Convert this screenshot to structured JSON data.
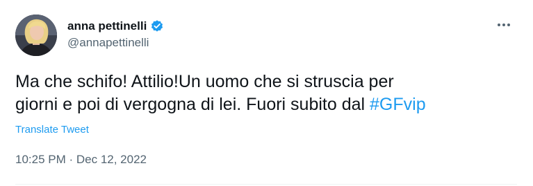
{
  "tweet": {
    "author": {
      "display_name": "anna pettinelli",
      "handle": "@annapettinelli",
      "verified": true,
      "avatar_icon": "avatar-photo"
    },
    "text_line1": "Ma che schifo! Attilio!Un uomo che si struscia per",
    "text_line2": "giorni e poi di vergogna di lei. Fuori subito dal ",
    "hashtag": "#GFvip",
    "translate_label": "Translate Tweet",
    "time": "10:25 PM",
    "separator": " · ",
    "date": "Dec 12, 2022",
    "more_icon": "more-horizontal-icon"
  },
  "colors": {
    "link": "#1d9bf0",
    "text_primary": "#0f1419",
    "text_secondary": "#536471",
    "verified": "#1d9bf0",
    "divider": "#eff3f4"
  }
}
